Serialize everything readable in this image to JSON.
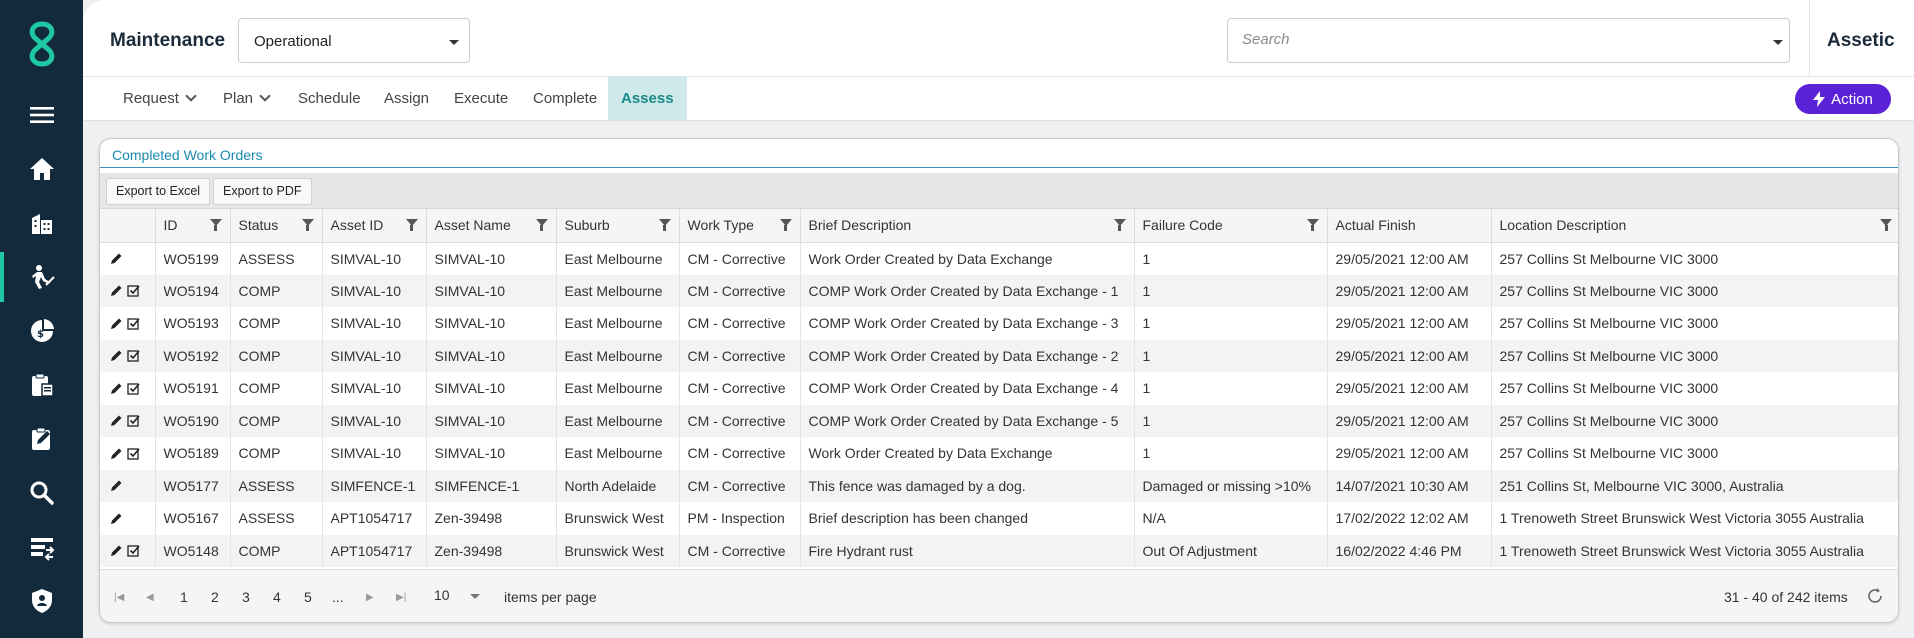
{
  "header": {
    "title": "Maintenance",
    "view_select": "Operational",
    "search_placeholder": "Search",
    "brand": "Assetic"
  },
  "tabs": [
    {
      "label": "Request",
      "dropdown": true
    },
    {
      "label": "Plan",
      "dropdown": true
    },
    {
      "label": "Schedule"
    },
    {
      "label": "Assign"
    },
    {
      "label": "Execute"
    },
    {
      "label": "Complete"
    },
    {
      "label": "Assess",
      "active": true
    }
  ],
  "action_label": "Action",
  "card": {
    "title": "Completed Work Orders",
    "export_excel": "Export to Excel",
    "export_pdf": "Export to PDF"
  },
  "columns": [
    "ID",
    "Status",
    "Asset ID",
    "Asset Name",
    "Suburb",
    "Work Type",
    "Brief Description",
    "Failure Code",
    "Actual Finish",
    "Location Description"
  ],
  "rows": [
    {
      "check": false,
      "id": "WO5199",
      "status": "ASSESS",
      "asset_id": "SIMVAL-10",
      "asset_name": "SIMVAL-10",
      "suburb": "East Melbourne",
      "work_type": "CM - Corrective",
      "desc": "Work Order Created by Data Exchange",
      "failure": "1",
      "finish": "29/05/2021 12:00 AM",
      "location": "257 Collins St Melbourne VIC 3000"
    },
    {
      "check": true,
      "id": "WO5194",
      "status": "COMP",
      "asset_id": "SIMVAL-10",
      "asset_name": "SIMVAL-10",
      "suburb": "East Melbourne",
      "work_type": "CM - Corrective",
      "desc": "COMP Work Order Created by Data Exchange - 1",
      "failure": "1",
      "finish": "29/05/2021 12:00 AM",
      "location": "257 Collins St Melbourne VIC 3000"
    },
    {
      "check": true,
      "id": "WO5193",
      "status": "COMP",
      "asset_id": "SIMVAL-10",
      "asset_name": "SIMVAL-10",
      "suburb": "East Melbourne",
      "work_type": "CM - Corrective",
      "desc": "COMP Work Order Created by Data Exchange - 3",
      "failure": "1",
      "finish": "29/05/2021 12:00 AM",
      "location": "257 Collins St Melbourne VIC 3000"
    },
    {
      "check": true,
      "id": "WO5192",
      "status": "COMP",
      "asset_id": "SIMVAL-10",
      "asset_name": "SIMVAL-10",
      "suburb": "East Melbourne",
      "work_type": "CM - Corrective",
      "desc": "COMP Work Order Created by Data Exchange - 2",
      "failure": "1",
      "finish": "29/05/2021 12:00 AM",
      "location": "257 Collins St Melbourne VIC 3000"
    },
    {
      "check": true,
      "id": "WO5191",
      "status": "COMP",
      "asset_id": "SIMVAL-10",
      "asset_name": "SIMVAL-10",
      "suburb": "East Melbourne",
      "work_type": "CM - Corrective",
      "desc": "COMP Work Order Created by Data Exchange - 4",
      "failure": "1",
      "finish": "29/05/2021 12:00 AM",
      "location": "257 Collins St Melbourne VIC 3000"
    },
    {
      "check": true,
      "id": "WO5190",
      "status": "COMP",
      "asset_id": "SIMVAL-10",
      "asset_name": "SIMVAL-10",
      "suburb": "East Melbourne",
      "work_type": "CM - Corrective",
      "desc": "COMP Work Order Created by Data Exchange - 5",
      "failure": "1",
      "finish": "29/05/2021 12:00 AM",
      "location": "257 Collins St Melbourne VIC 3000"
    },
    {
      "check": true,
      "id": "WO5189",
      "status": "COMP",
      "asset_id": "SIMVAL-10",
      "asset_name": "SIMVAL-10",
      "suburb": "East Melbourne",
      "work_type": "CM - Corrective",
      "desc": "Work Order Created by Data Exchange",
      "failure": "1",
      "finish": "29/05/2021 12:00 AM",
      "location": "257 Collins St Melbourne VIC 3000"
    },
    {
      "check": false,
      "id": "WO5177",
      "status": "ASSESS",
      "asset_id": "SIMFENCE-1",
      "asset_name": "SIMFENCE-1",
      "suburb": "North Adelaide",
      "work_type": "CM - Corrective",
      "desc": "This fence was damaged by a dog.",
      "failure": "Damaged or missing >10%",
      "finish": "14/07/2021 10:30 AM",
      "location": "251 Collins St, Melbourne VIC 3000, Australia"
    },
    {
      "check": false,
      "id": "WO5167",
      "status": "ASSESS",
      "asset_id": "APT1054717",
      "asset_name": "Zen-39498",
      "suburb": "Brunswick West",
      "work_type": "PM - Inspection",
      "desc": "Brief description has been changed",
      "failure": "N/A",
      "finish": "17/02/2022 12:02 AM",
      "location": "1 Trenoweth Street Brunswick West Victoria 3055 Australia"
    },
    {
      "check": true,
      "id": "WO5148",
      "status": "COMP",
      "asset_id": "APT1054717",
      "asset_name": "Zen-39498",
      "suburb": "Brunswick West",
      "work_type": "CM - Corrective",
      "desc": "Fire Hydrant rust",
      "failure": "Out Of Adjustment",
      "finish": "16/02/2022 4:46 PM",
      "location": "1 Trenoweth Street Brunswick West Victoria 3055 Australia"
    }
  ],
  "pager": {
    "pages": [
      "1",
      "2",
      "3",
      "4",
      "5",
      "..."
    ],
    "per_page": "10",
    "per_page_label": "items per page",
    "info": "31 - 40 of 242 items"
  },
  "colors": {
    "sidebar": "#122a3c",
    "accent": "#20c7a3",
    "action": "#5b21d6",
    "link": "#1a8ab0"
  },
  "sidebar_icons": [
    "menu-icon",
    "home-icon",
    "buildings-icon",
    "worker-icon",
    "finance-icon",
    "clipboard-icon",
    "task-icon",
    "search-icon",
    "data-exchange-icon",
    "shield-icon"
  ]
}
